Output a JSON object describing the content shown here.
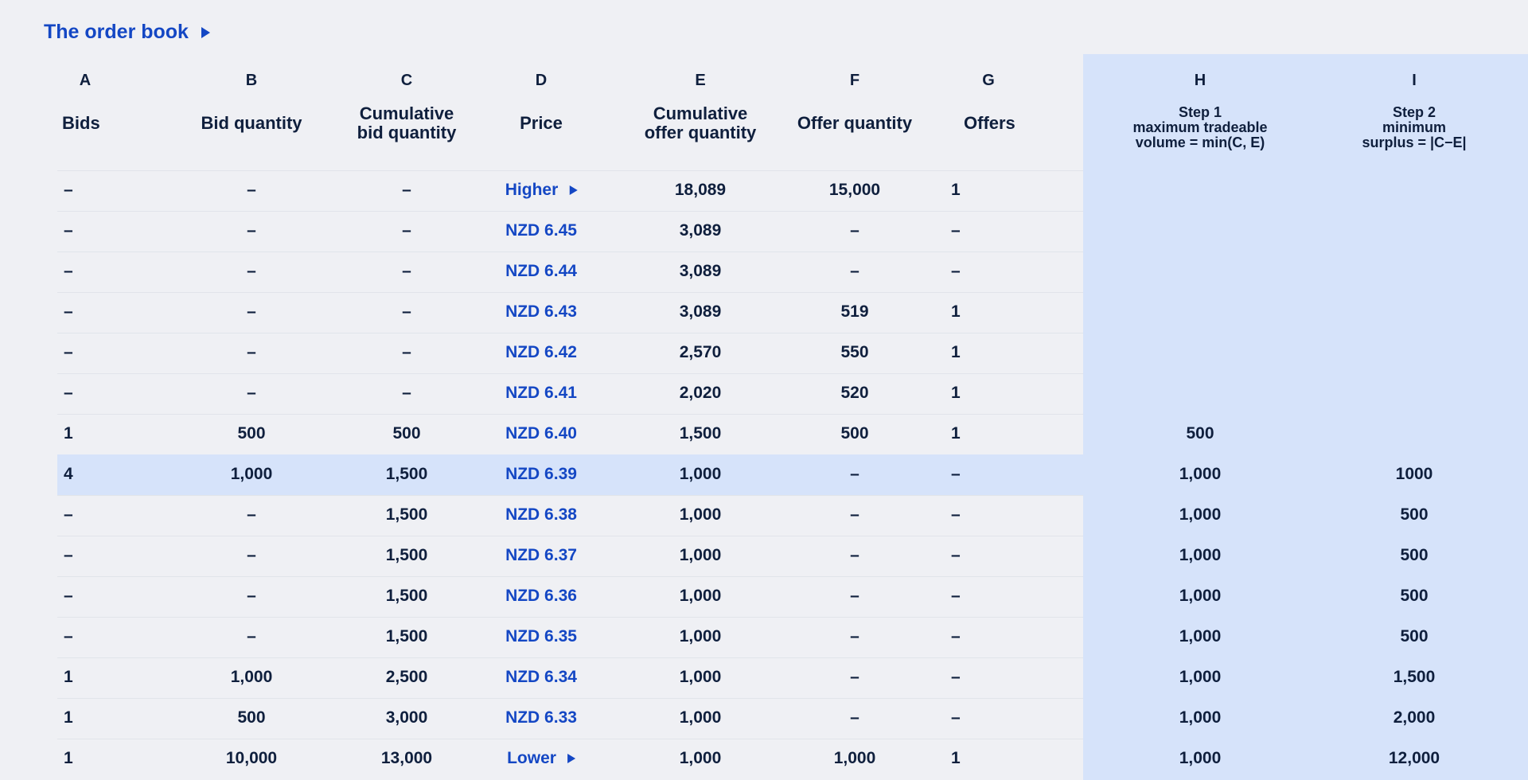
{
  "title": "The order book",
  "columns": [
    {
      "letter": "A",
      "header": [
        "Bids"
      ]
    },
    {
      "letter": "B",
      "header": [
        "Bid quantity"
      ]
    },
    {
      "letter": "C",
      "header": [
        "Cumulative",
        "bid quantity"
      ]
    },
    {
      "letter": "D",
      "header": [
        "Price"
      ]
    },
    {
      "letter": "E",
      "header": [
        "Cumulative",
        "offer quantity"
      ]
    },
    {
      "letter": "F",
      "header": [
        "Offer quantity"
      ]
    },
    {
      "letter": "G",
      "header": [
        "Offers"
      ]
    },
    {
      "letter": "H",
      "header": [
        "Step 1",
        "maximum tradeable",
        "volume = min(C, E)"
      ]
    },
    {
      "letter": "I",
      "header": [
        "Step 2",
        "minimum",
        "surplus = |C−E|"
      ]
    }
  ],
  "rows": [
    {
      "bids": "–",
      "bid_qty": "–",
      "cum_bid": "–",
      "price": "Higher",
      "cum_offer": "18,089",
      "offer_qty": "15,000",
      "offers": "1",
      "step1": "",
      "step2": ""
    },
    {
      "bids": "–",
      "bid_qty": "–",
      "cum_bid": "–",
      "price": "NZD 6.45",
      "cum_offer": "3,089",
      "offer_qty": "–",
      "offers": "–",
      "step1": "",
      "step2": ""
    },
    {
      "bids": "–",
      "bid_qty": "–",
      "cum_bid": "–",
      "price": "NZD 6.44",
      "cum_offer": "3,089",
      "offer_qty": "–",
      "offers": "–",
      "step1": "",
      "step2": ""
    },
    {
      "bids": "–",
      "bid_qty": "–",
      "cum_bid": "–",
      "price": "NZD 6.43",
      "cum_offer": "3,089",
      "offer_qty": "519",
      "offers": "1",
      "step1": "",
      "step2": ""
    },
    {
      "bids": "–",
      "bid_qty": "–",
      "cum_bid": "–",
      "price": "NZD 6.42",
      "cum_offer": "2,570",
      "offer_qty": "550",
      "offers": "1",
      "step1": "",
      "step2": ""
    },
    {
      "bids": "–",
      "bid_qty": "–",
      "cum_bid": "–",
      "price": "NZD 6.41",
      "cum_offer": "2,020",
      "offer_qty": "520",
      "offers": "1",
      "step1": "",
      "step2": ""
    },
    {
      "bids": "1",
      "bid_qty": "500",
      "cum_bid": "500",
      "price": "NZD 6.40",
      "cum_offer": "1,500",
      "offer_qty": "500",
      "offers": "1",
      "step1": "500",
      "step2": ""
    },
    {
      "bids": "4",
      "bid_qty": "1,000",
      "cum_bid": "1,500",
      "price": "NZD 6.39",
      "cum_offer": "1,000",
      "offer_qty": "–",
      "offers": "–",
      "step1": "1,000",
      "step2": "1000"
    },
    {
      "bids": "–",
      "bid_qty": "–",
      "cum_bid": "1,500",
      "price": "NZD 6.38",
      "cum_offer": "1,000",
      "offer_qty": "–",
      "offers": "–",
      "step1": "1,000",
      "step2": "500"
    },
    {
      "bids": "–",
      "bid_qty": "–",
      "cum_bid": "1,500",
      "price": "NZD 6.37",
      "cum_offer": "1,000",
      "offer_qty": "–",
      "offers": "–",
      "step1": "1,000",
      "step2": "500"
    },
    {
      "bids": "–",
      "bid_qty": "–",
      "cum_bid": "1,500",
      "price": "NZD 6.36",
      "cum_offer": "1,000",
      "offer_qty": "–",
      "offers": "–",
      "step1": "1,000",
      "step2": "500"
    },
    {
      "bids": "–",
      "bid_qty": "–",
      "cum_bid": "1,500",
      "price": "NZD 6.35",
      "cum_offer": "1,000",
      "offer_qty": "–",
      "offers": "–",
      "step1": "1,000",
      "step2": "500"
    },
    {
      "bids": "1",
      "bid_qty": "1,000",
      "cum_bid": "2,500",
      "price": "NZD 6.34",
      "cum_offer": "1,000",
      "offer_qty": "–",
      "offers": "–",
      "step1": "1,000",
      "step2": "1,500"
    },
    {
      "bids": "1",
      "bid_qty": "500",
      "cum_bid": "3,000",
      "price": "NZD 6.33",
      "cum_offer": "1,000",
      "offer_qty": "–",
      "offers": "–",
      "step1": "1,000",
      "step2": "2,000"
    },
    {
      "bids": "1",
      "bid_qty": "10,000",
      "cum_bid": "13,000",
      "price": "Lower",
      "cum_offer": "1,000",
      "offer_qty": "1,000",
      "offers": "1",
      "step1": "1,000",
      "step2": "12,000"
    }
  ],
  "highlighted_row": 7,
  "colors": {
    "accent": "#1447c4",
    "highlight": "#d6e3fa",
    "background": "#eff0f4",
    "text": "#0f1f3d"
  },
  "icons": {
    "title": "triangle-right-icon",
    "higher": "triangle-right-icon",
    "lower": "triangle-right-icon"
  }
}
